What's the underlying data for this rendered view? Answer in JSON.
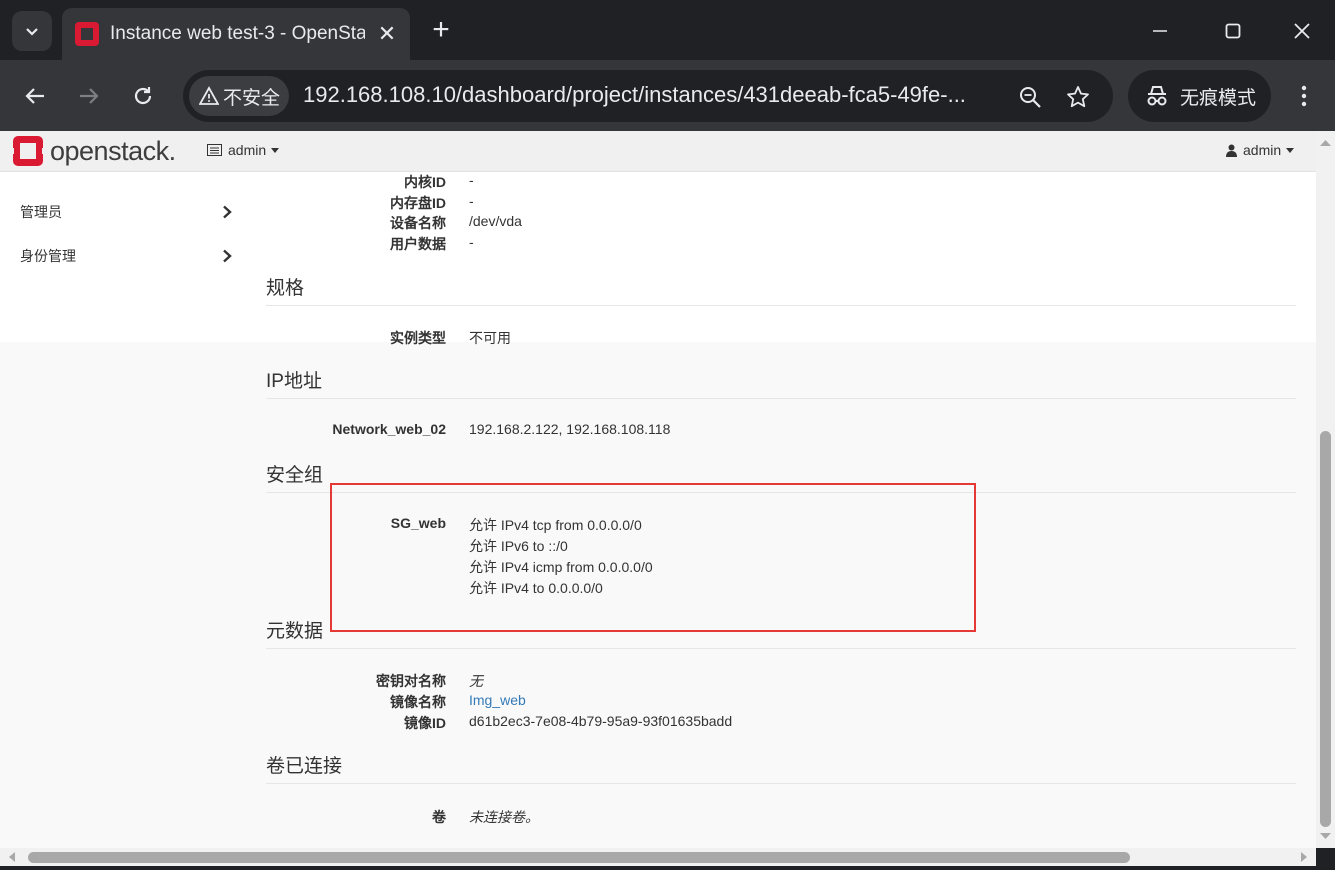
{
  "browser": {
    "tab_title": "Instance web test-3 - OpenStack",
    "insecure_label": "不安全",
    "url": "192.168.108.10/dashboard/project/instances/431deeab-fca5-49fe-...",
    "incognito_label": "无痕模式",
    "accent": "#e8eaed"
  },
  "openstack": {
    "logo_text": "openstack.",
    "project_label": "admin",
    "user_label": "admin",
    "brand_color": "#da1a32"
  },
  "sidebar": {
    "items": [
      {
        "label": "管理员"
      },
      {
        "label": "身份管理"
      }
    ]
  },
  "content": {
    "top_rows": [
      {
        "key": "内核ID",
        "value": "-"
      },
      {
        "key": "内存盘ID",
        "value": "-"
      },
      {
        "key": "设备名称",
        "value": "/dev/vda"
      },
      {
        "key": "用户数据",
        "value": "-"
      }
    ],
    "flavor": {
      "heading": "规格",
      "rows": [
        {
          "key": "实例类型",
          "value": "不可用"
        }
      ]
    },
    "ip": {
      "heading": "IP地址",
      "rows": [
        {
          "key": "Network_web_02",
          "value": "192.168.2.122, 192.168.108.118"
        }
      ]
    },
    "secgroup": {
      "heading": "安全组",
      "name": "SG_web",
      "rules": [
        "允许 IPv4 tcp from 0.0.0.0/0",
        "允许 IPv6 to ::/0",
        "允许 IPv4 icmp from 0.0.0.0/0",
        "允许 IPv4 to 0.0.0.0/0"
      ]
    },
    "metadata": {
      "heading": "元数据",
      "rows": [
        {
          "key": "密钥对名称",
          "value": "无"
        },
        {
          "key": "镜像名称",
          "value": "Img_web"
        },
        {
          "key": "镜像ID",
          "value": "d61b2ec3-7e08-4b79-95a9-93f01635badd"
        }
      ]
    },
    "volumes": {
      "heading": "卷已连接",
      "rows": [
        {
          "key": "卷",
          "value": "未连接卷。"
        }
      ]
    }
  },
  "annotation_color": "#e53935"
}
